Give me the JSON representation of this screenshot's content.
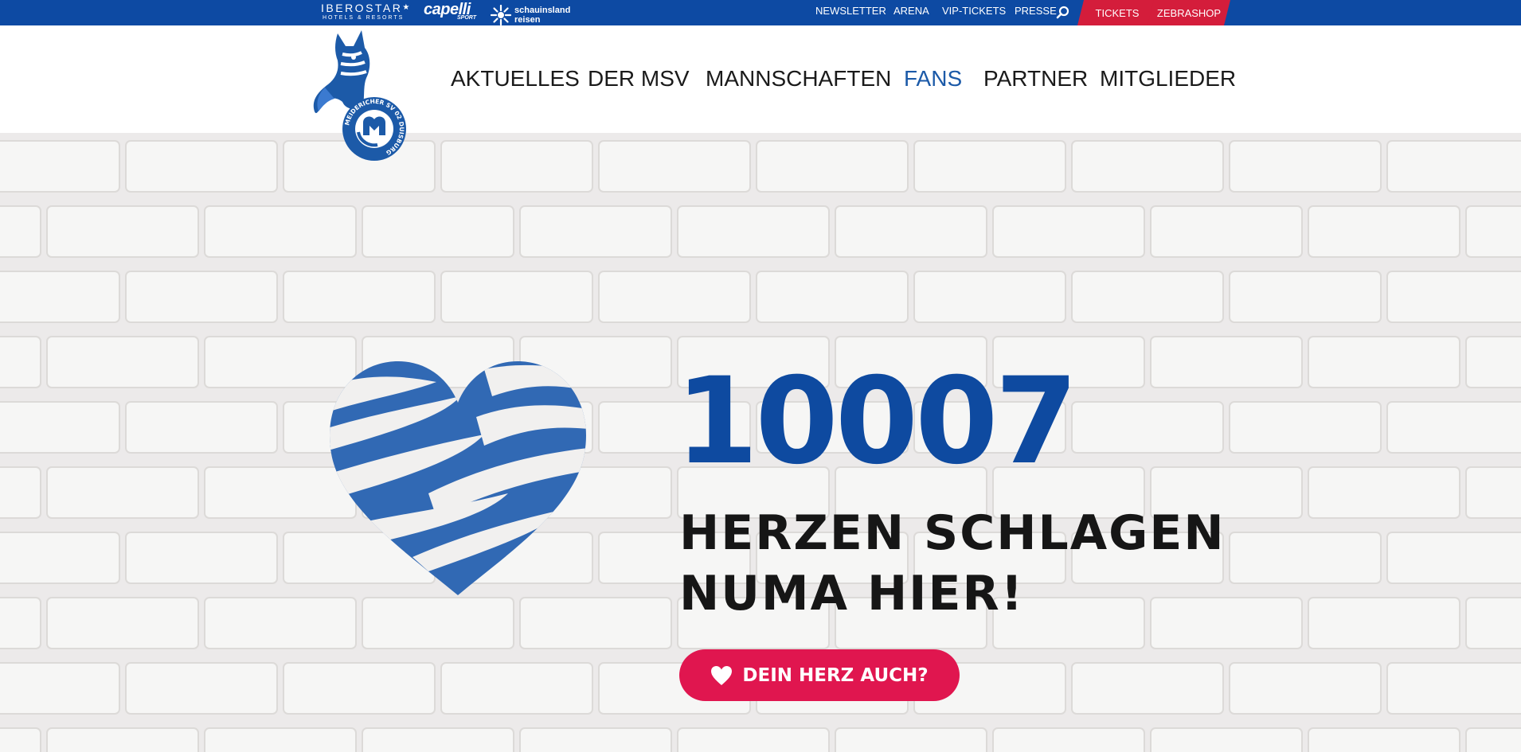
{
  "sponsors": {
    "iberostar": {
      "name": "IBEROSTAR",
      "sub": "HOTELS & RESORTS"
    },
    "capelli": {
      "name": "capelli",
      "sub": "SPORT"
    },
    "schauinsland": {
      "line1": "schauinsland",
      "line2": "reisen"
    }
  },
  "toplinks": [
    "NEWSLETTER",
    "ARENA",
    "VIP-TICKETS",
    "PRESSE"
  ],
  "tabs": {
    "tickets": "TICKETS",
    "zebrashop": "ZEBRASHOP"
  },
  "mainnav": [
    {
      "label": "AKTUELLES",
      "active": false
    },
    {
      "label": "DER MSV",
      "active": false
    },
    {
      "label": "MANNSCHAFTEN",
      "active": false
    },
    {
      "label": "FANS",
      "active": true
    },
    {
      "label": "PARTNER",
      "active": false
    },
    {
      "label": "MITGLIEDER",
      "active": false
    }
  ],
  "logo": {
    "ring_text": "MEIDERICHER SV 02 DUISBURG"
  },
  "hero": {
    "count": "10007",
    "tagline_line1": "HERZEN SCHLAGEN",
    "tagline_line2": "NUMA HIER!",
    "cta_label": "DEIN HERZ AUCH?"
  },
  "colors": {
    "topbar": "#0d4aa3",
    "accent_red": "#d41d3b",
    "cta_pink": "#e0164f",
    "brand_blue": "#0e4aa0",
    "active_nav": "#1c5aa8"
  }
}
